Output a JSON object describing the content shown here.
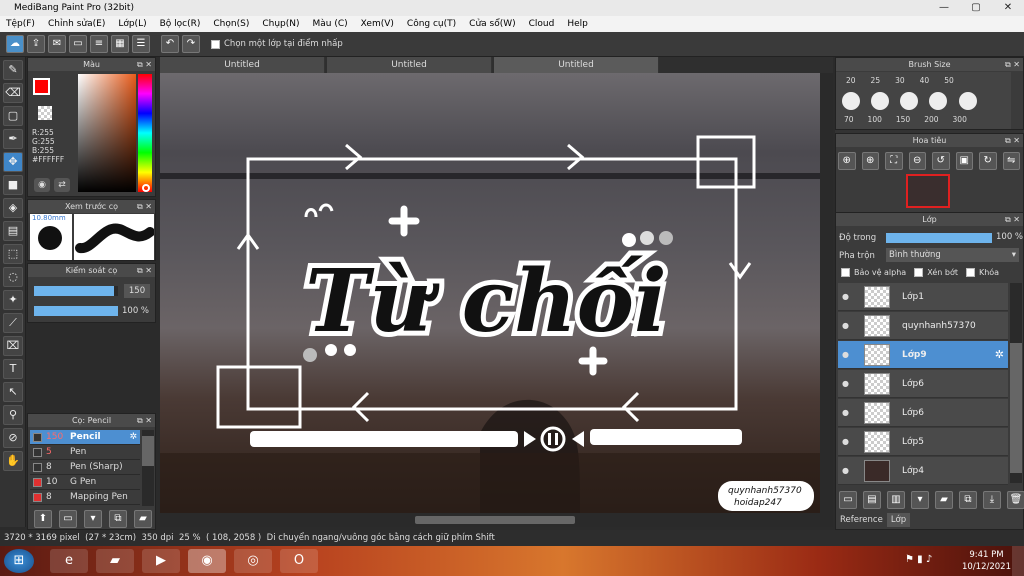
{
  "window": {
    "title": "MediBang Paint Pro (32bit)",
    "controls": [
      "—",
      "▢",
      "✕"
    ]
  },
  "menu": [
    "Tệp(F)",
    "Chỉnh sửa(E)",
    "Lớp(L)",
    "Bộ lọc(R)",
    "Chọn(S)",
    "Chụp(N)",
    "Màu (C)",
    "Xem(V)",
    "Công cụ(T)",
    "Cửa sổ(W)",
    "Cloud",
    "Help"
  ],
  "toolbar": {
    "select_layer_label": "Chọn một lớp tại điểm nhấp"
  },
  "tabs": [
    "Untitled",
    "Untitled",
    "Untitled"
  ],
  "color_panel": {
    "title": "Màu",
    "r": "R:255",
    "g": "G:255",
    "b": "B:255",
    "hex": "#FFFFFF",
    "primary": "#ff0000",
    "secondary": "#ffffff"
  },
  "brush_preview": {
    "title": "Xem trước cọ",
    "size_label": "10.80mm"
  },
  "brush_control": {
    "title": "Kiểm soát cọ",
    "size": "150",
    "opacity": "100 %",
    "size_fraction": 0.95,
    "opacity_fraction": 1.0
  },
  "brush_list": {
    "title": "Cọ: Pencil",
    "items": [
      {
        "size": "150",
        "name": "Pencil",
        "color": "#333333",
        "selected": true
      },
      {
        "size": "5",
        "name": "Pen",
        "color": "#333333"
      },
      {
        "size": "8",
        "name": "Pen (Sharp)",
        "color": "#333333"
      },
      {
        "size": "10",
        "name": "G Pen",
        "color": "#e03030"
      },
      {
        "size": "8",
        "name": "Mapping Pen",
        "color": "#e03030"
      }
    ]
  },
  "brush_size": {
    "title": "Brush Size",
    "top_row": [
      "20",
      "25",
      "30",
      "40",
      "50"
    ],
    "bottom_row": [
      "70",
      "100",
      "150",
      "200",
      "300"
    ]
  },
  "navigator": {
    "title": "Hoa tiêu"
  },
  "layer_panel": {
    "title": "Lớp",
    "opacity_label": "Độ trong",
    "opacity_value": "100 %",
    "blend_label": "Pha trộn",
    "blend_value": "Bình thường",
    "protect_alpha": "Bảo vệ alpha",
    "clipping": "Xén bớt",
    "lock": "Khóa",
    "layers": [
      "Lớp1",
      "quynhanh57370",
      "Lớp9",
      "Lớp6",
      "Lớp6",
      "Lớp5",
      "Lớp4"
    ],
    "selected_index": 2,
    "bottom_tabs": [
      "Reference",
      "Lớp"
    ]
  },
  "canvas_art": {
    "title": "Từ chối",
    "watermark_line1": "quynhanh57370",
    "watermark_line2": "hoidap247"
  },
  "status": {
    "size": "3720 * 3169 pixel",
    "cm": "(27 * 23cm)",
    "dpi": "350 dpi",
    "zoom": "25 %",
    "coords": "( 108, 2058 )",
    "hint": "Di chuyển ngang/vuông góc bằng cách giữ phím Shift"
  },
  "taskbar": {
    "time": "9:41 PM",
    "date": "10/12/2021"
  },
  "colors": {
    "accent": "#4d8fd1",
    "selected_layer": "#4d8fd1"
  }
}
